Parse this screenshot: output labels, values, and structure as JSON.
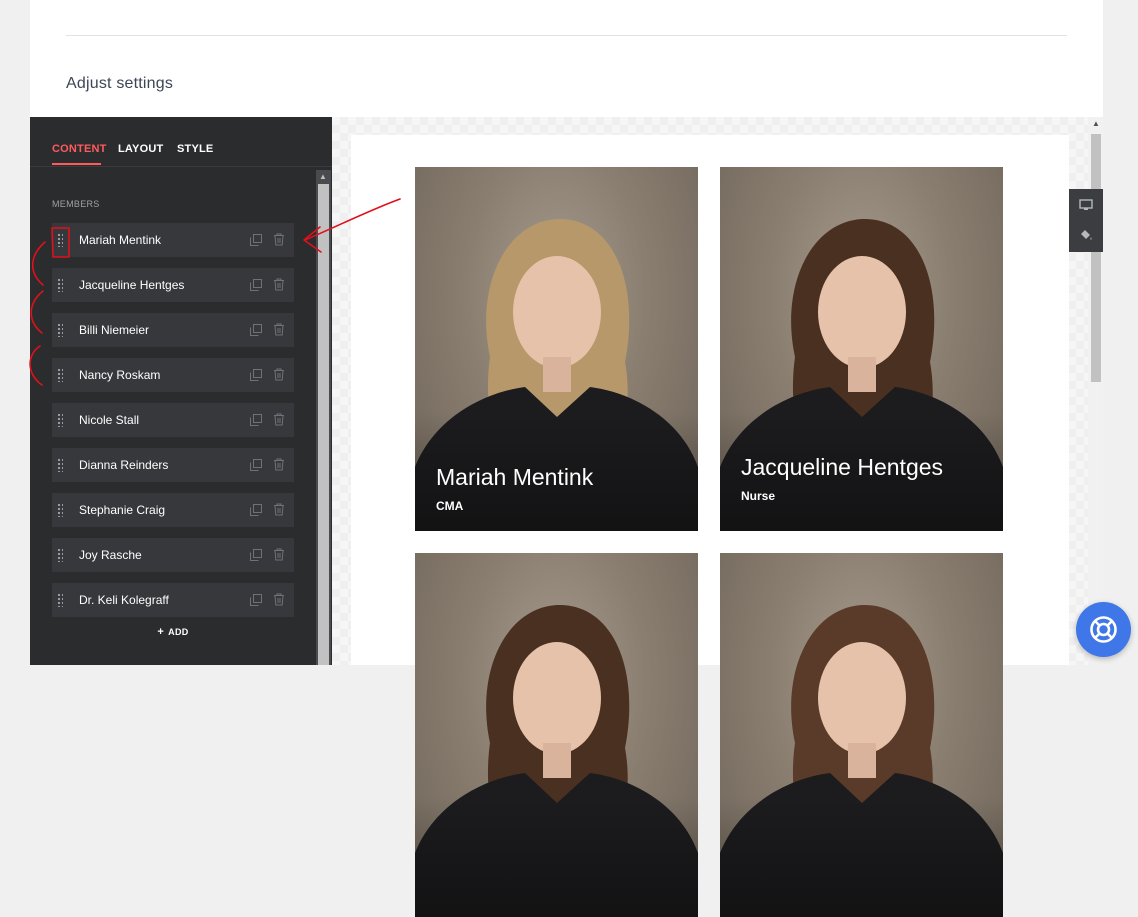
{
  "page": {
    "heading": "Adjust settings"
  },
  "editor": {
    "tabs": [
      {
        "label": "CONTENT",
        "active": true
      },
      {
        "label": "LAYOUT",
        "active": false
      },
      {
        "label": "STYLE",
        "active": false
      }
    ],
    "members_label": "MEMBERS",
    "members": [
      {
        "name": "Mariah Mentink"
      },
      {
        "name": "Jacqueline Hentges"
      },
      {
        "name": "Billi Niemeier"
      },
      {
        "name": "Nancy Roskam"
      },
      {
        "name": "Nicole Stall"
      },
      {
        "name": "Dianna Reinders"
      },
      {
        "name": "Stephanie Craig"
      },
      {
        "name": "Joy Rasche"
      },
      {
        "name": "Dr. Keli Kolegraff"
      }
    ],
    "add_label": "ADD",
    "row_icons": {
      "drag": "drag-handle-icon",
      "duplicate": "duplicate-icon",
      "delete": "trash-icon"
    }
  },
  "preview": {
    "cards": [
      {
        "name": "Mariah Mentink",
        "role": "CMA",
        "hair": "blonde"
      },
      {
        "name": "Jacqueline Hentges",
        "role": "Nurse",
        "hair": "brunette"
      },
      {
        "name": "",
        "role": "",
        "hair": "brunette"
      },
      {
        "name": "",
        "role": "",
        "hair": "brown"
      }
    ]
  },
  "toolbar": {
    "icons": [
      "desktop-icon",
      "paint-bucket-icon"
    ]
  },
  "help": {
    "icon": "lifebuoy-icon",
    "color": "#3f77e8"
  },
  "colors": {
    "accent": "#ff5a5f",
    "panel": "#2b2c2e",
    "annotation": "#e0101c"
  }
}
